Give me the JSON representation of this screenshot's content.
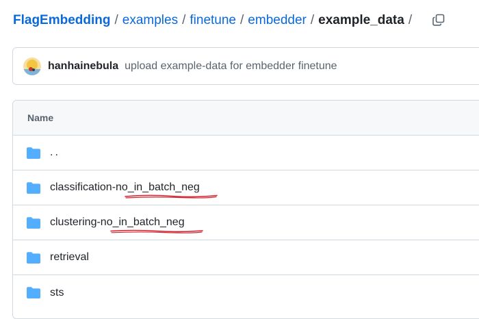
{
  "breadcrumb": {
    "items": [
      "FlagEmbedding",
      "examples",
      "finetune",
      "embedder"
    ],
    "separator": "/",
    "current": "example_data"
  },
  "commit": {
    "author": "hanhainebula",
    "message": "upload example-data for embedder finetune"
  },
  "file_table": {
    "header": "Name",
    "rows": [
      {
        "name": "..",
        "type": "parent-directory",
        "icon": "folder-icon"
      },
      {
        "name": "classification-no_in_batch_neg",
        "type": "directory",
        "icon": "folder-icon",
        "annotated": true
      },
      {
        "name": "clustering-no_in_batch_neg",
        "type": "directory",
        "icon": "folder-icon",
        "annotated": true
      },
      {
        "name": "retrieval",
        "type": "directory",
        "icon": "folder-icon"
      },
      {
        "name": "sts",
        "type": "directory",
        "icon": "folder-icon"
      }
    ]
  },
  "colors": {
    "link": "#0969da",
    "text": "#1f2328",
    "muted": "#59636e",
    "border": "#d1d9e0",
    "header_bg": "#f6f8fa",
    "folder": "#54aeff",
    "annotation": "#d1242f"
  }
}
